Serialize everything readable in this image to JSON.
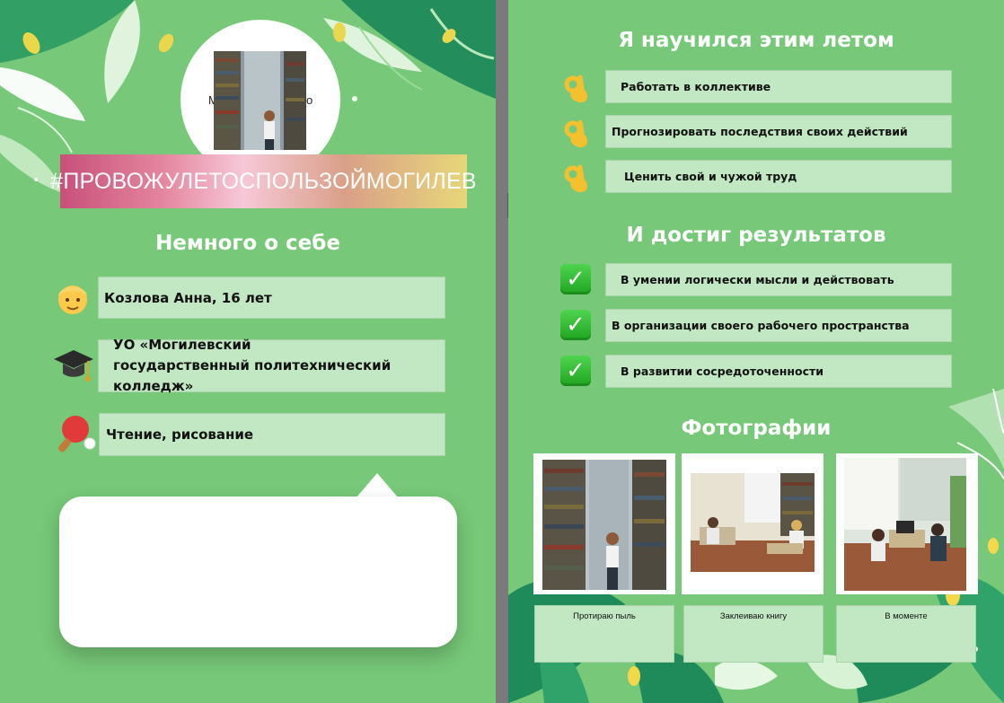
{
  "left_page": {
    "avatar_text": "М",
    "avatar_text_right": "о",
    "hashtag": "#ПРОВОЖУЛЕТОСПОЛЬЗОЙМОГИЛЕВ",
    "about_heading": "Немного о себе",
    "info": [
      {
        "icon": "person-icon",
        "text": "Козлова Анна, 16 лет"
      },
      {
        "icon": "graduation-cap-icon",
        "text": "УО «Могилевский государственный политехнический колледж»"
      },
      {
        "icon": "ping-pong-icon",
        "text": "Чтение, рисование"
      }
    ]
  },
  "right_page": {
    "learned_heading": "Я научился этим летом",
    "learned": [
      {
        "icon": "ok-hand-icon",
        "text": "Работать в коллективе"
      },
      {
        "icon": "ok-hand-icon",
        "text": "Прогнозировать последствия своих действий"
      },
      {
        "icon": "ok-hand-icon",
        "text": "Ценить свой и чужой труд"
      }
    ],
    "results_heading": "И достиг результатов",
    "results": [
      {
        "icon": "check-mark-icon",
        "text": "В умении логически мысли и действовать"
      },
      {
        "icon": "check-mark-icon",
        "text": "В организации своего рабочего пространства"
      },
      {
        "icon": "check-mark-icon",
        "text": "В развитии сосредоточенности"
      }
    ],
    "photos_heading": "Фотографии",
    "photos": [
      {
        "caption": "Протираю пыль"
      },
      {
        "caption": "Заклеиваю книгу"
      },
      {
        "caption": "В моменте"
      }
    ]
  },
  "colors": {
    "page_background": "#77c878",
    "box_fill": "#c2e8c3",
    "leaf_dark": "#1f8a5a",
    "leaf_light": "#d8f2d6"
  }
}
